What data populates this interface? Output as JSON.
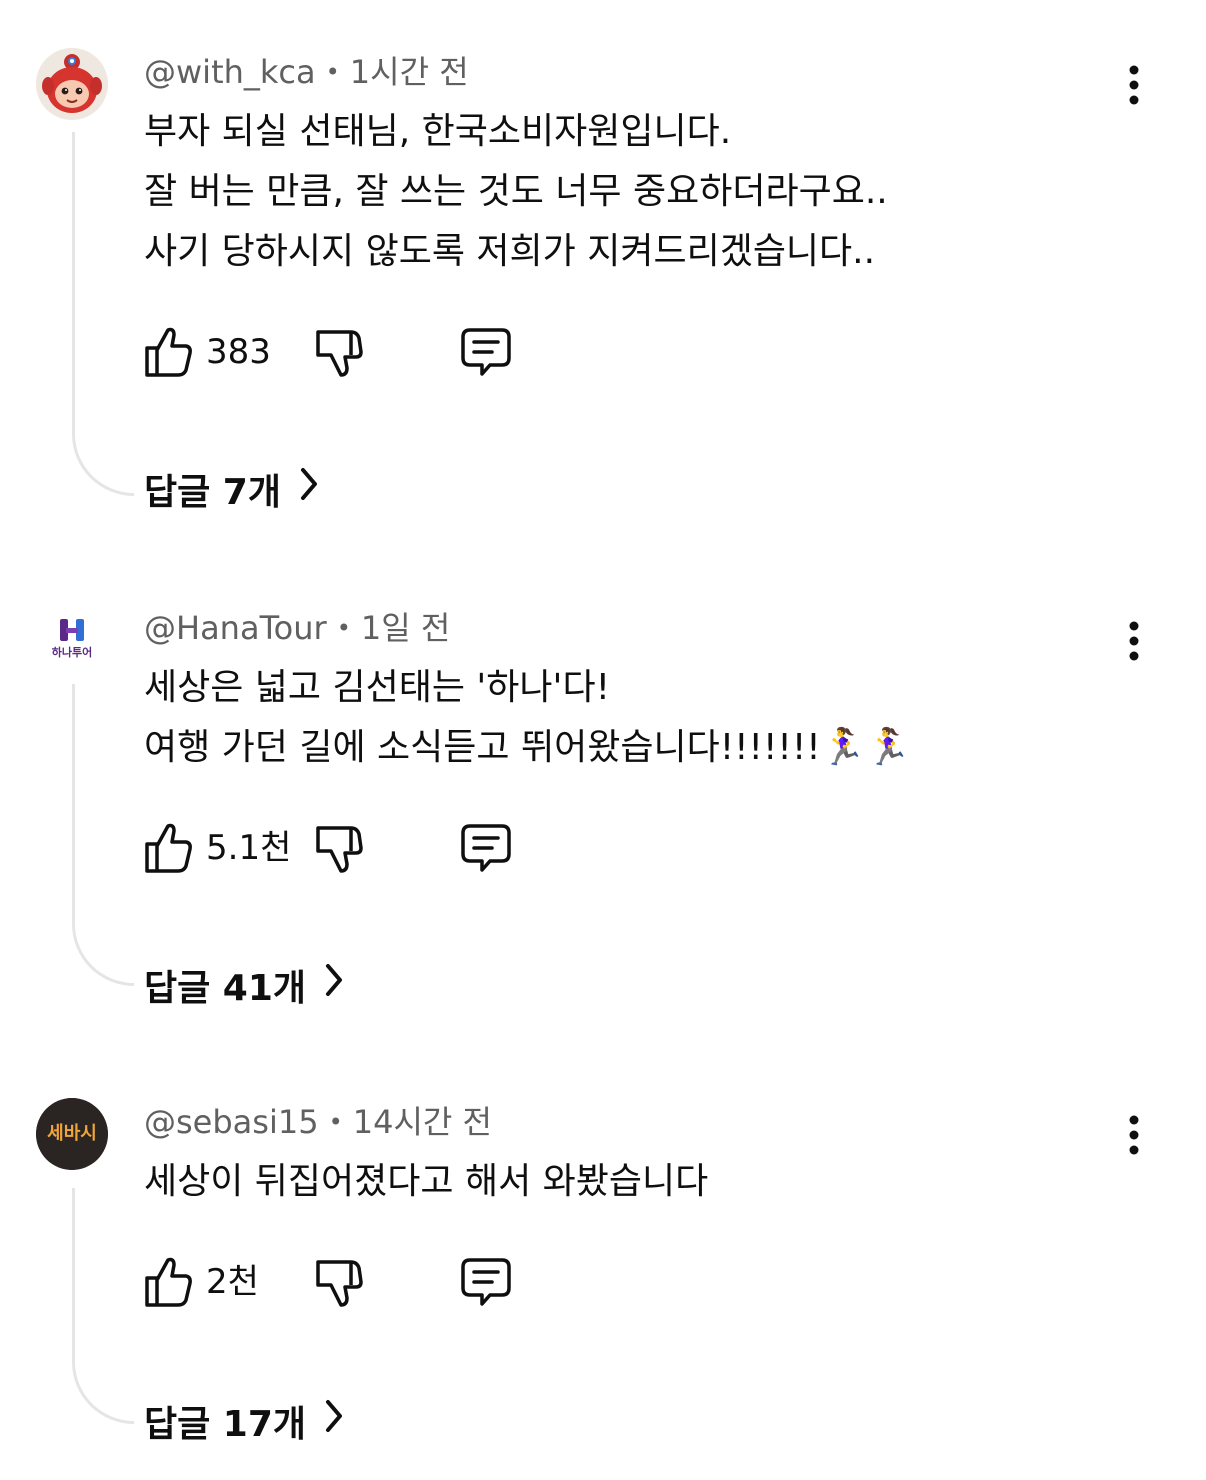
{
  "comments": [
    {
      "author": "@with_kca",
      "separator": "•",
      "time": "1시간 전",
      "lines": [
        "부자 되실 선태님, 한국소비자원입니다.",
        "잘 버는 만큼, 잘 쓰는 것도 너무 중요하더라구요..",
        "사기 당하시지 않도록 저희가 지켜드리겠습니다.."
      ],
      "likes": "383",
      "replies": "답글 7개",
      "avatar_icon": "mascot-avatar",
      "avatar_color": "#d6342f"
    },
    {
      "author": "@HanaTour",
      "separator": "•",
      "time": "1일 전",
      "lines": [
        "세상은 넓고 김선태는 '하나'다!",
        "여행 가던 길에 소식듣고 뛰어왔습니다!!!!!!!🏃‍♀️🏃‍♀️"
      ],
      "likes": "5.1천",
      "replies": "답글 41개",
      "avatar_icon": "hanatour-logo",
      "avatar_logo_text": "하나투어",
      "avatar_color": "#5b2a86"
    },
    {
      "author": "@sebasi15",
      "separator": "•",
      "time": "14시간 전",
      "lines": [
        "세상이 뒤집어졌다고 해서 와봤습니다"
      ],
      "likes": "2천",
      "replies": "답글 17개",
      "avatar_icon": "sebasi-logo",
      "avatar_logo_text": "세바시",
      "avatar_color": "#2a2522"
    }
  ],
  "colors": {
    "meta": "#606060",
    "text": "#0f0f0f",
    "thread_line": "#e5e5e5",
    "sebasi_text": "#f0a53a"
  }
}
